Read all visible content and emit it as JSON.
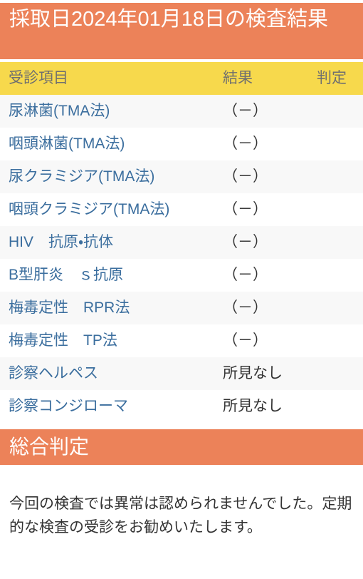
{
  "theme": {
    "banner_orange": "#ec8259",
    "header_yellow": "#f7d94c",
    "row_alt_gray": "#f8f8f8",
    "link_blue": "#3b6e9e",
    "body_text": "#333333",
    "header_text_gray": "#6f6f6f",
    "banner_text": "#ffffff"
  },
  "header": {
    "title": "採取日2024年01月18日の検査結果"
  },
  "table": {
    "columns": {
      "item": "受診項目",
      "result": "結果",
      "judgement": "判定"
    },
    "rows": [
      {
        "item": "尿淋菌(TMA法)",
        "result": "（－）",
        "judgement": ""
      },
      {
        "item": "咽頭淋菌(TMA法)",
        "result": "（－）",
        "judgement": ""
      },
      {
        "item": "尿クラミジア(TMA法)",
        "result": "（－）",
        "judgement": ""
      },
      {
        "item": "咽頭クラミジア(TMA法)",
        "result": "（－）",
        "judgement": ""
      },
      {
        "item": "HIV　抗原・抗体",
        "result": "（－）",
        "judgement": ""
      },
      {
        "item": "B型肝炎　ｓ抗原",
        "result": "（－）",
        "judgement": ""
      },
      {
        "item": "梅毒定性　RPR法",
        "result": "（－）",
        "judgement": ""
      },
      {
        "item": "梅毒定性　TP法",
        "result": "（－）",
        "judgement": ""
      },
      {
        "item": "診察ヘルペス",
        "result": "所見なし",
        "judgement": ""
      },
      {
        "item": "診察コンジローマ",
        "result": "所見なし",
        "judgement": ""
      }
    ]
  },
  "overall": {
    "heading": "総合判定",
    "comment": "今回の検査では異常は認められませんでした。定期的な検査の受診をお勧めいたします。"
  }
}
